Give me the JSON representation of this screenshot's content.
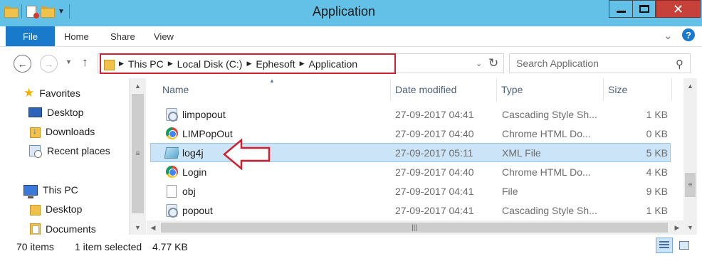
{
  "window": {
    "title": "Application"
  },
  "ribbon": {
    "file": "File",
    "tabs": [
      "Home",
      "Share",
      "View"
    ]
  },
  "address": {
    "crumbs": [
      "This PC",
      "Local Disk (C:)",
      "Ephesoft",
      "Application"
    ]
  },
  "search": {
    "placeholder": "Search Application"
  },
  "navpane": {
    "favorites": "Favorites",
    "fav_items": [
      "Desktop",
      "Downloads",
      "Recent places"
    ],
    "thispc": "This PC",
    "pc_items": [
      "Desktop",
      "Documents"
    ]
  },
  "columns": {
    "name": "Name",
    "date": "Date modified",
    "type": "Type",
    "size": "Size"
  },
  "files": [
    {
      "name": "limpopout",
      "date": "27-09-2017 04:41",
      "type": "Cascading Style Sh...",
      "size": "1 KB",
      "icon": "css-file-icon"
    },
    {
      "name": "LIMPopOut",
      "date": "27-09-2017 04:40",
      "type": "Chrome HTML Do...",
      "size": "0 KB",
      "icon": "chrome-icon"
    },
    {
      "name": "log4j",
      "date": "27-09-2017 05:11",
      "type": "XML File",
      "size": "5 KB",
      "icon": "xml-file-icon"
    },
    {
      "name": "Login",
      "date": "27-09-2017 04:40",
      "type": "Chrome HTML Do...",
      "size": "4 KB",
      "icon": "chrome-icon"
    },
    {
      "name": "obj",
      "date": "27-09-2017 04:41",
      "type": "File",
      "size": "9 KB",
      "icon": "file-icon"
    },
    {
      "name": "popout",
      "date": "27-09-2017 04:41",
      "type": "Cascading Style Sh...",
      "size": "1 KB",
      "icon": "css-file-icon"
    }
  ],
  "status": {
    "count": "70 items",
    "selected": "1 item selected",
    "size": "4.77 KB"
  },
  "colors": {
    "titlebar": "#63c1e8",
    "file_tab": "#1979ca",
    "selection": "#cce4f7",
    "annotation": "#d1202f",
    "close": "#c8403a"
  }
}
